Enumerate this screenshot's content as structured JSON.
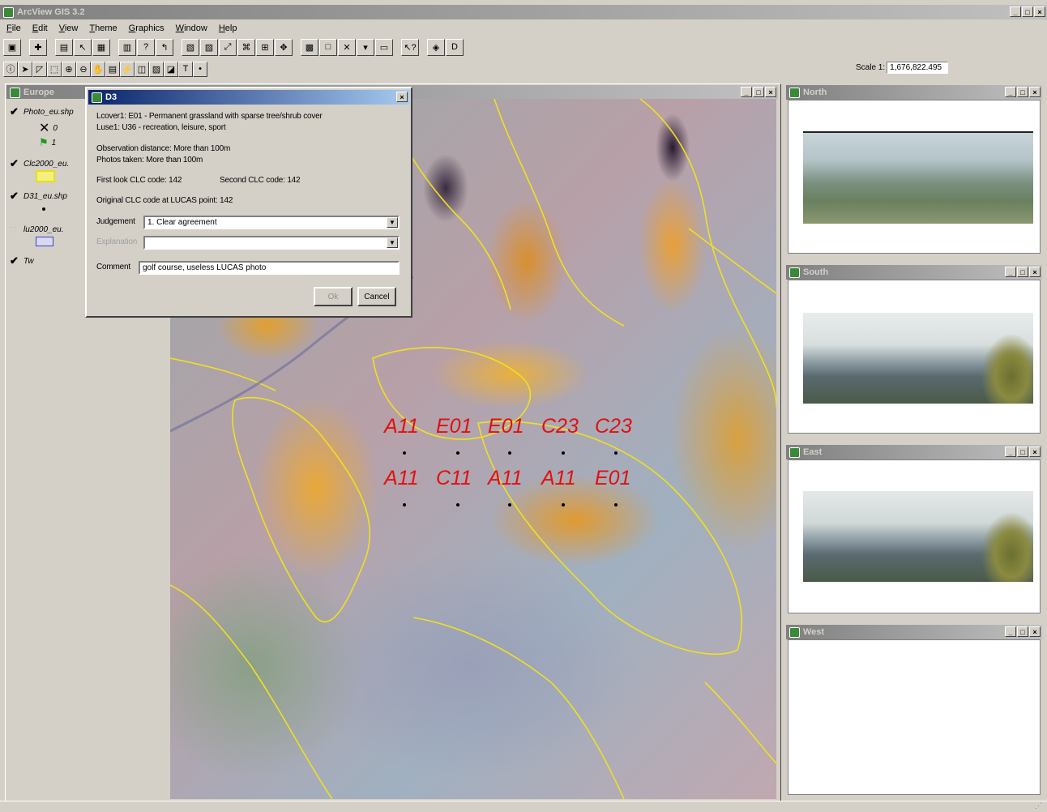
{
  "app": {
    "title": "ArcView GIS 3.2"
  },
  "menu": [
    "File",
    "Edit",
    "View",
    "Theme",
    "Graphics",
    "Window",
    "Help"
  ],
  "scale": {
    "label": "Scale 1:",
    "value": "1,676,822.495"
  },
  "map_window": {
    "title": "Europe"
  },
  "toc": {
    "layers": [
      {
        "name": "Photo_eu.shp",
        "checked": true,
        "legend": [
          "0",
          "1"
        ]
      },
      {
        "name": "Clc2000_eu.",
        "checked": true
      },
      {
        "name": "D31_eu.shp",
        "checked": true
      },
      {
        "name": "lu2000_eu.",
        "checked": false
      },
      {
        "name": "Tw",
        "checked": true
      }
    ]
  },
  "dialog": {
    "title": "D3",
    "lcover": "Lcover1: E01 - Permanent grassland with sparse tree/shrub cover",
    "luse": "Luse1: U36 - recreation, leisure, sport",
    "obs_distance": "Observation distance: More than 100m",
    "photos_taken": "Photos taken: More than 100m",
    "first_look": "First look CLC code: 142",
    "second_clc": "Second CLC code: 142",
    "original_clc": "Original CLC code at LUCAS point: 142",
    "judgement_label": "Judgement",
    "judgement_value": "1. Clear agreement",
    "explanation_label": "Explanation",
    "explanation_value": "",
    "comment_label": "Comment",
    "comment_value": "golf course, useless LUCAS photo",
    "ok_label": "Ok",
    "cancel_label": "Cancel"
  },
  "map_labels": {
    "row1": [
      "A11",
      "E01",
      "E01",
      "C23",
      "C23"
    ],
    "row2": [
      "A11",
      "C11",
      "A11",
      "A11",
      "E01"
    ]
  },
  "photo_windows": [
    {
      "title": "North"
    },
    {
      "title": "South"
    },
    {
      "title": "East"
    },
    {
      "title": "West"
    }
  ],
  "colors": {
    "title_active": "#0a246a",
    "label_red": "#e01010",
    "polygon_yellow": "#f0e020"
  }
}
